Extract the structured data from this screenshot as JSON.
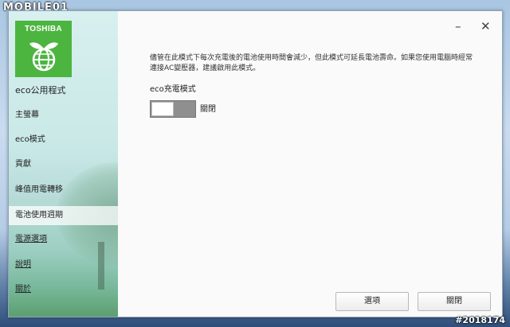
{
  "watermark": {
    "site": "MOBILE01",
    "id": "#2018174"
  },
  "sidebar": {
    "brand": "TOSHIBA",
    "app_title": "eco公用程式",
    "items": [
      {
        "label": "主螢幕"
      },
      {
        "label": "eco模式"
      },
      {
        "label": "貢獻"
      },
      {
        "label": "峰值用電轉移"
      },
      {
        "label": "電池使用週期"
      },
      {
        "label": "電源選項"
      },
      {
        "label": "說明"
      },
      {
        "label": "關於"
      }
    ]
  },
  "window_controls": {
    "minimize": "–",
    "close": "✕"
  },
  "main": {
    "description": "儘管在此模式下每次充電後的電池使用時間會減少，但此模式可延長電池壽命。如果您使用電腦時經常連接AC變壓器，建議啟用此模式。",
    "mode_label": "eco充電模式",
    "toggle_state": "關閉",
    "toggle_on": false
  },
  "buttons": {
    "options": "選項",
    "close": "關閉"
  },
  "colors": {
    "brand_green": "#4cb540",
    "toggle_gray": "#8f8f8f"
  }
}
